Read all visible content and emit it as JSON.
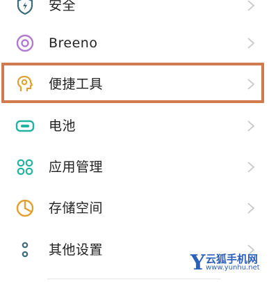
{
  "settings_list": {
    "items": [
      {
        "label": "安全",
        "icon": "shield-icon",
        "color": "#3a6b7a"
      },
      {
        "label": "Breeno",
        "icon": "breeno-icon",
        "color": "#b07ad0"
      },
      {
        "label": "便捷工具",
        "icon": "convenience-tools-icon",
        "color": "#e0a030"
      },
      {
        "label": "电池",
        "icon": "battery-icon",
        "color": "#22b3a0"
      },
      {
        "label": "应用管理",
        "icon": "app-management-icon",
        "color": "#22b3a0"
      },
      {
        "label": "存储空间",
        "icon": "storage-icon",
        "color": "#e0a030"
      },
      {
        "label": "其他设置",
        "icon": "more-settings-icon",
        "color": "#3a6b7a"
      }
    ]
  },
  "highlight": {
    "color": "#d07a4e",
    "target": "便捷工具"
  },
  "watermark": {
    "logo": "Y",
    "name": "云狐手机网",
    "url": "www.yunhu.net",
    "color": "#2c5fb8"
  }
}
